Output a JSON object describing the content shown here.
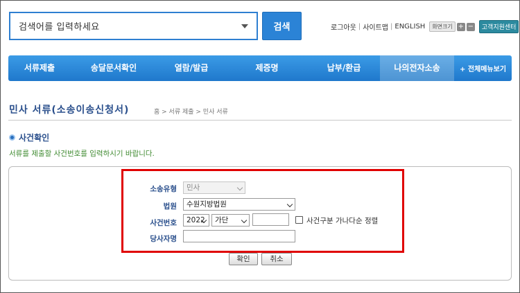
{
  "search": {
    "placeholder": "검색어를 입력하세요",
    "button_label": "검색"
  },
  "util": {
    "logout": "로그아웃",
    "sitemap": "사이트맵",
    "english": "ENGLISH",
    "zoom_label": "화면크기",
    "zoom_in": "+",
    "zoom_out": "−",
    "help_center": "고객지원센터"
  },
  "nav": {
    "items": [
      {
        "label": "서류제출"
      },
      {
        "label": "송달문서확인"
      },
      {
        "label": "열람/발급"
      },
      {
        "label": "제증명"
      },
      {
        "label": "납부/환급"
      },
      {
        "label": "나의전자소송"
      }
    ],
    "all_menu": "+ 전체메뉴보기"
  },
  "page": {
    "title": "민사 서류(소송이송신청서)",
    "breadcrumb": "홈 > 서류 제출 > 민사 서류"
  },
  "section": {
    "title": "사건확인",
    "guide": "서류를 제출할 사건번호를 입력하시기 바랍니다."
  },
  "form": {
    "lawsuit_type_label": "소송유형",
    "lawsuit_type_value": "민사",
    "court_label": "법원",
    "court_value": "수원지방법원",
    "case_no_label": "사건번호",
    "case_year": "2022",
    "case_code": "가단",
    "case_number": "",
    "sort_checkbox_label": "사건구분 가나다순 정렬",
    "party_label": "당사자명",
    "party_value": ""
  },
  "buttons": {
    "confirm": "확인",
    "cancel": "취소"
  },
  "colors": {
    "accent": "#2b83d6",
    "nav": "#1f78cc",
    "highlight": "#e00000",
    "title": "#2a4f8c",
    "guide": "#3f8a30"
  }
}
